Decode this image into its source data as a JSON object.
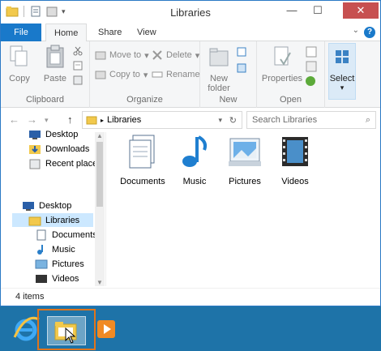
{
  "window": {
    "title": "Libraries"
  },
  "tabs": [
    {
      "label": "File"
    },
    {
      "label": "Home"
    },
    {
      "label": "Share"
    },
    {
      "label": "View"
    }
  ],
  "ribbon": {
    "clipboard": {
      "label": "Clipboard",
      "copy": "Copy",
      "paste": "Paste"
    },
    "organize": {
      "label": "Organize",
      "move_to": "Move to",
      "copy_to": "Copy to",
      "delete": "Delete",
      "rename": "Rename"
    },
    "new": {
      "label": "New",
      "new_folder_line1": "New",
      "new_folder_line2": "folder"
    },
    "open": {
      "label": "Open",
      "properties": "Properties"
    },
    "select": {
      "label": "Select"
    }
  },
  "address": {
    "path": "Libraries",
    "search_placeholder": "Search Libraries"
  },
  "nav": {
    "items": [
      {
        "label": "Desktop"
      },
      {
        "label": "Downloads"
      },
      {
        "label": "Recent places"
      },
      {
        "label": "Desktop"
      },
      {
        "label": "Libraries"
      },
      {
        "label": "Documents"
      },
      {
        "label": "Music"
      },
      {
        "label": "Pictures"
      },
      {
        "label": "Videos"
      }
    ]
  },
  "libraries": [
    {
      "label": "Documents",
      "icon": "documents-library-icon"
    },
    {
      "label": "Music",
      "icon": "music-library-icon"
    },
    {
      "label": "Pictures",
      "icon": "pictures-library-icon"
    },
    {
      "label": "Videos",
      "icon": "videos-library-icon"
    }
  ],
  "status": {
    "count": "4 items"
  },
  "colors": {
    "accent": "#1979ca",
    "taskbar": "#1e73a8",
    "highlight": "#e0751c",
    "close": "#c75050"
  }
}
